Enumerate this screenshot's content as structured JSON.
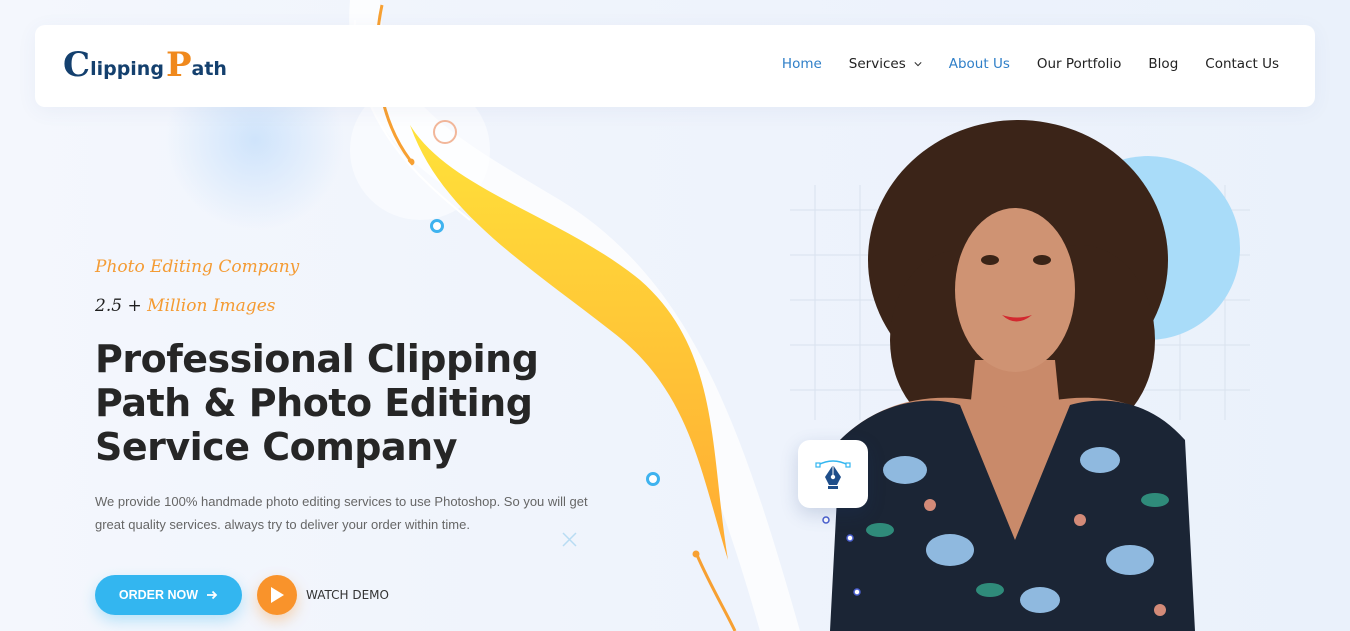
{
  "logo": {
    "letter_c": "C",
    "word1": "lipping",
    "letter_p": "P",
    "word2": "ath"
  },
  "nav": {
    "items": [
      {
        "label": "Home"
      },
      {
        "label": "Services"
      },
      {
        "label": "About Us"
      },
      {
        "label": "Our Portfolio"
      },
      {
        "label": "Blog"
      },
      {
        "label": "Contact Us"
      }
    ]
  },
  "hero": {
    "eyebrow": "Photo Editing Company",
    "stat_prefix": "2.5 + ",
    "stat_highlight": "Million Images",
    "headline": "Professional Clipping Path & Photo Editing Service Company",
    "description": "We provide 100% handmade photo editing services to use Photoshop. So you will get great quality services. always try to deliver your order within time.",
    "order_button": "ORDER NOW",
    "watch_label": "WATCH DEMO"
  },
  "icons": {
    "order_arrow": "arrow-right-icon",
    "services_chevron": "chevron-down-icon",
    "play": "play-icon",
    "tool_card": "pen-tool-icon"
  },
  "colors": {
    "accent_blue": "#33b6f0",
    "accent_orange": "#f49b33",
    "nav_active": "#2f7fc8",
    "brand_navy": "#14406e"
  }
}
